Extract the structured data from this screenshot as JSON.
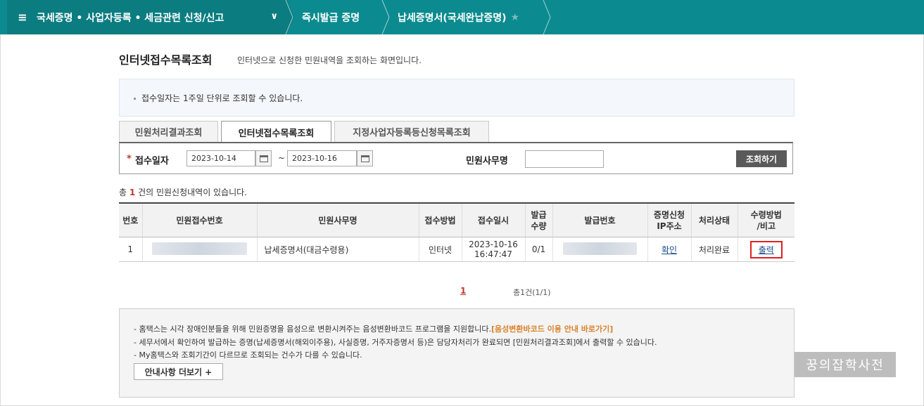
{
  "nav": {
    "breadcrumb1": "국세증명 • 사업자등록 • 세금관련 신청/신고",
    "breadcrumb2": "즉시발급 증명",
    "breadcrumb3": "납세증명서(국세완납증명)",
    "menu_icon": "menu-icon",
    "dropdown_icon": "chevron-down-icon",
    "star_icon": "star-icon"
  },
  "page": {
    "title": "인터넷접수목록조회",
    "description": "인터넷으로 신청한 민원내역을 조회하는 화면입니다."
  },
  "notice": "접수일자는 1주일 단위로 조회할 수 있습니다.",
  "tabs": [
    {
      "label": "민원처리결과조회",
      "active": false
    },
    {
      "label": "인터넷접수목록조회",
      "active": true
    },
    {
      "label": "지정사업자등록등신청목록조회",
      "active": false
    }
  ],
  "search": {
    "required_mark": "*",
    "date_label": "접수일자",
    "date_from": "2023-10-14",
    "date_to": "2023-10-16",
    "tilde": "~",
    "name_label": "민원사무명",
    "name_value": "",
    "button": "조회하기"
  },
  "result_count": {
    "prefix": "총",
    "count": "1",
    "suffix": "건의 민원신청내역이 있습니다."
  },
  "table": {
    "headers": [
      "번호",
      "민원접수번호",
      "민원사무명",
      "접수방법",
      "접수일시",
      "발급\n수량",
      "발급번호",
      "증명신청\nIP주소",
      "처리상태",
      "수령방법\n/비고"
    ],
    "rows": [
      {
        "no": "1",
        "receipt_no": "",
        "name": "납세증명서(대금수령용)",
        "method": "인터넷",
        "date": "2023-10-16",
        "time": "16:47:47",
        "qty": "0/1",
        "issue_no": "",
        "ip": "확인",
        "status": "처리완료",
        "action": "출력"
      }
    ]
  },
  "pager": {
    "current": "1",
    "total": "총1건(1/1)"
  },
  "info": {
    "line1_text": "- 홈택스는 시각 장애인분들을 위해 민원증명을 음성으로 변환시켜주는 음성변환바코드 프로그램을 지원합니다.",
    "line1_link": "[음성변환바코드 이용 안내 바로가기]",
    "line2": "- 세무서에서 확인하여 발급하는 증명(납세증명서(해외이주용), 사실증명, 거주자증명서 등)은 담당자처리가 완료되면 [민원처리결과조회]에서 출력할 수 있습니다.",
    "line3": "- My홈택스와 조회기간이 다르므로 조회되는 건수가 다를 수 있습니다.",
    "more_button": "안내사항 더보기 +"
  },
  "watermark": "꿍의잡학사전",
  "colors": {
    "nav_bg": "#0b8b8f",
    "accent_red": "#c0392b",
    "highlight_box": "#e02020",
    "orange_link": "#d9822b"
  }
}
